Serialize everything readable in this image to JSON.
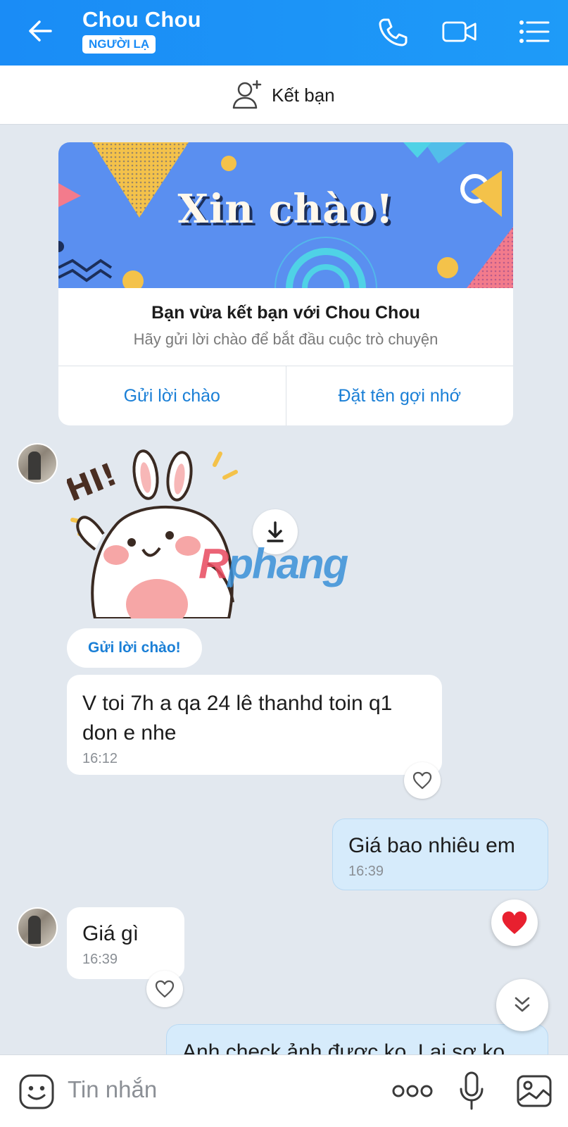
{
  "header": {
    "title": "Chou Chou",
    "badge": "NGƯỜI LẠ",
    "icons": [
      "back-arrow-icon",
      "phone-icon",
      "video-call-icon",
      "menu-list-icon"
    ]
  },
  "add_friend": {
    "label": "Kết bạn"
  },
  "welcome_card": {
    "banner_text": "Xin chào!",
    "title": "Bạn vừa kết bạn với Chou Chou",
    "subtitle": "Hãy gửi lời chào để bắt đầu cuộc trò chuyện",
    "button_greet": "Gửi lời chào",
    "button_nickname": "Đặt tên gợi nhớ"
  },
  "sticker": {
    "text": "HI!",
    "watermark_r": "R",
    "watermark_rest": "phang"
  },
  "quick_reply": {
    "label": "Gửi lời chào!"
  },
  "messages": [
    {
      "side": "in",
      "text_line1": "V toi 7h a qa 24 lê thanhd toin q1",
      "text_line2": "don e nhe",
      "time": "16:12"
    },
    {
      "side": "out",
      "text": "Giá bao nhiêu em",
      "time": "16:39"
    },
    {
      "side": "in",
      "text": "Giá gì",
      "time": "16:39"
    },
    {
      "side": "out",
      "text": "Anh check ảnh được ko. Lại sợ ko"
    }
  ],
  "composer": {
    "placeholder": "Tin nhắn"
  },
  "colors": {
    "header": "#1a8cf6",
    "accent_text": "#1a7fd6",
    "chat_bg": "#e2e8ef",
    "out_bubble": "#d6ebfb",
    "heart": "#e8202f"
  }
}
